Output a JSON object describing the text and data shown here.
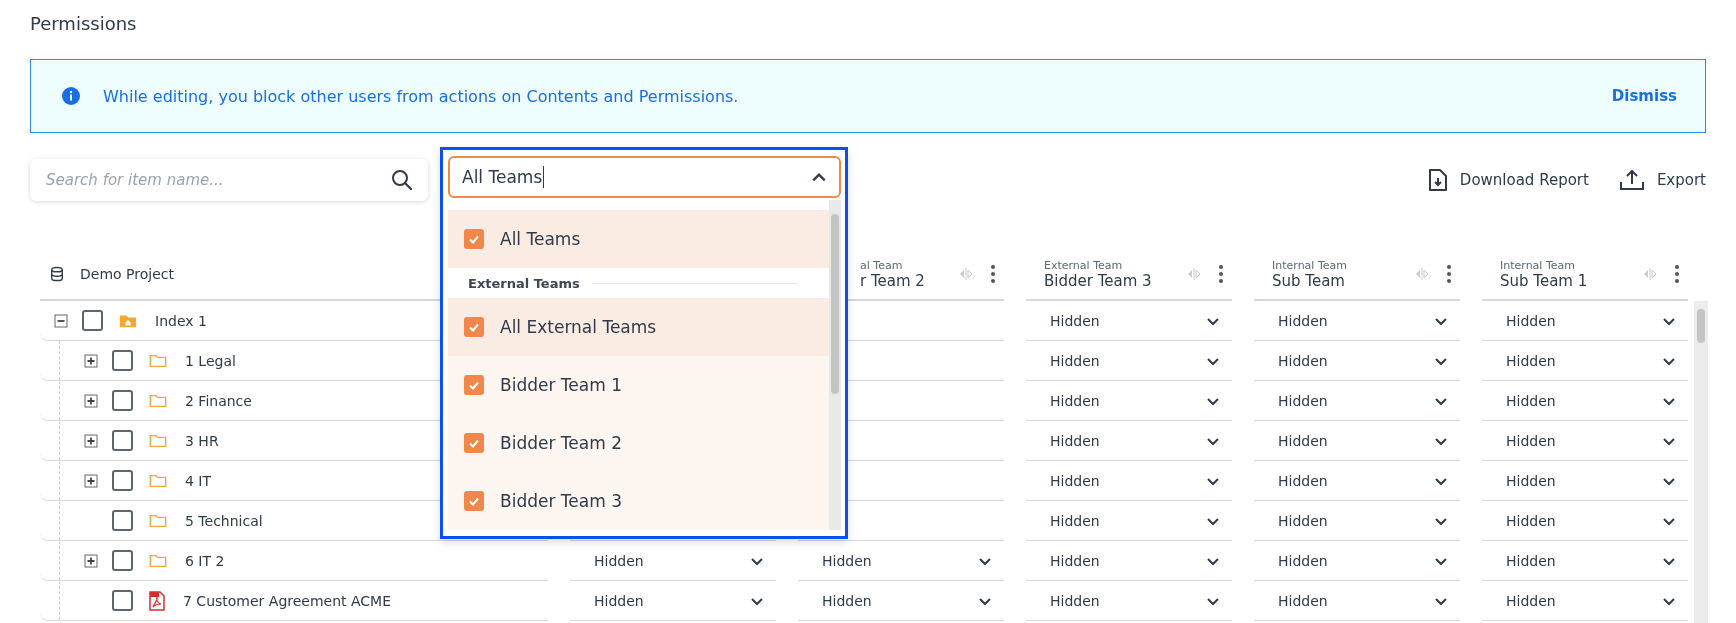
{
  "title": "Permissions",
  "banner": {
    "message": "While editing, you block other users from actions on Contents and Permissions.",
    "action": "Dismiss"
  },
  "search": {
    "placeholder": "Search for item name..."
  },
  "team_filter": {
    "value": "All Teams",
    "expanded": true,
    "options": [
      {
        "kind": "option",
        "label": "All Teams",
        "checked": true,
        "highlighted": true
      },
      {
        "kind": "group",
        "label": "External Teams"
      },
      {
        "kind": "option",
        "label": "All External Teams",
        "checked": true,
        "highlighted": true
      },
      {
        "kind": "option",
        "label": "Bidder Team 1",
        "checked": true,
        "highlighted": false
      },
      {
        "kind": "option",
        "label": "Bidder Team 2",
        "checked": true,
        "highlighted": false
      },
      {
        "kind": "option",
        "label": "Bidder Team 3",
        "checked": true,
        "highlighted": false
      }
    ]
  },
  "actions": [
    {
      "kind": "download",
      "label": "Download Report"
    },
    {
      "kind": "export",
      "label": "Export"
    }
  ],
  "table": {
    "project": "Demo Project",
    "columns": [
      {},
      {
        "group": "al Team",
        "name": "r Team 2",
        "cut": true
      },
      {
        "group": "External Team",
        "name": "Bidder Team 3",
        "cut": false
      },
      {
        "group": "Internal Team",
        "name": "Sub Team",
        "cut": false
      },
      {
        "group": "Internal Team",
        "name": "Sub Team 1",
        "cut": false
      }
    ],
    "tree": [
      {
        "name": "Index 1",
        "kind": "home",
        "expandable": true,
        "expanded": true,
        "checked": false,
        "cells": [
          null,
          null,
          "Hidden",
          "Hidden",
          "Hidden"
        ],
        "children": [
          {
            "name": "1 Legal",
            "kind": "folder",
            "expandable": true,
            "expanded": false,
            "checked": false,
            "cells": [
              null,
              null,
              "Hidden",
              "Hidden",
              "Hidden"
            ]
          },
          {
            "name": "2 Finance",
            "kind": "folder",
            "expandable": true,
            "expanded": false,
            "checked": false,
            "cells": [
              null,
              null,
              "Hidden",
              "Hidden",
              "Hidden"
            ]
          },
          {
            "name": "3 HR",
            "kind": "folder",
            "expandable": true,
            "expanded": false,
            "checked": false,
            "cells": [
              null,
              null,
              "Hidden",
              "Hidden",
              "Hidden"
            ]
          },
          {
            "name": "4 IT",
            "kind": "folder",
            "expandable": true,
            "expanded": false,
            "checked": false,
            "cells": [
              null,
              null,
              "Hidden",
              "Hidden",
              "Hidden"
            ]
          },
          {
            "name": "5 Technical",
            "kind": "folder",
            "expandable": false,
            "checked": false,
            "cells": [
              null,
              null,
              "Hidden",
              "Hidden",
              "Hidden"
            ]
          },
          {
            "name": "6 IT 2",
            "kind": "folder",
            "expandable": true,
            "expanded": false,
            "checked": false,
            "cells": [
              "Hidden",
              "Hidden",
              "Hidden",
              "Hidden",
              "Hidden"
            ]
          },
          {
            "name": "7 Customer Agreement ACME",
            "kind": "pdf",
            "expandable": false,
            "checked": false,
            "cells": [
              "Hidden",
              "Hidden",
              "Hidden",
              "Hidden",
              "Hidden"
            ]
          }
        ]
      }
    ]
  }
}
